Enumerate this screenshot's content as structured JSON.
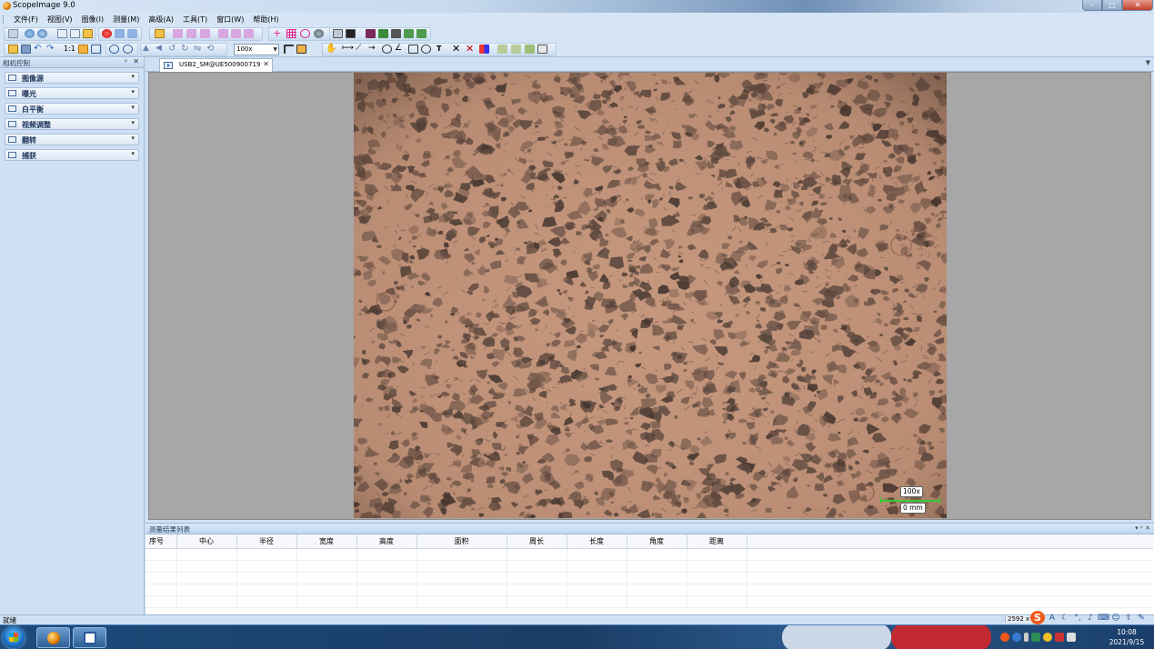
{
  "window": {
    "title": "ScopeImage 9.0",
    "min": "–",
    "max": "□",
    "close": "✕"
  },
  "menu": [
    {
      "label": "文件(F)"
    },
    {
      "label": "视图(V)"
    },
    {
      "label": "图像(I)"
    },
    {
      "label": "测量(M)"
    },
    {
      "label": "高级(A)"
    },
    {
      "label": "工具(T)"
    },
    {
      "label": "窗口(W)"
    },
    {
      "label": "帮助(H)"
    }
  ],
  "toolbar": {
    "one_to_one": "1:1",
    "zoom_value": "100x",
    "text_tool": "T"
  },
  "left_panel": {
    "title": "相机控制",
    "pin": "ᵖ",
    "close": "✕",
    "items": [
      {
        "label": "图像源"
      },
      {
        "label": "曝光"
      },
      {
        "label": "白平衡"
      },
      {
        "label": "视频调整"
      },
      {
        "label": "翻转"
      },
      {
        "label": "捕获"
      }
    ]
  },
  "document": {
    "tab_label": "USB2_SM@UE500900719",
    "tab_close": "✕",
    "scale_mag": "100x",
    "scale_len": "0 mm"
  },
  "results": {
    "title": "测量结果列表",
    "controls": "▾ ᵖ ✕",
    "columns": [
      "序号",
      "中心",
      "半径",
      "宽度",
      "高度",
      "面积",
      "周长",
      "长度",
      "角度",
      "距离"
    ]
  },
  "status": {
    "text": "就绪",
    "dims": "2592 x 1"
  },
  "ime": {
    "logo": "S",
    "mode": "A"
  },
  "taskbar": {
    "time": "10:08",
    "date": "2021/9/15"
  }
}
